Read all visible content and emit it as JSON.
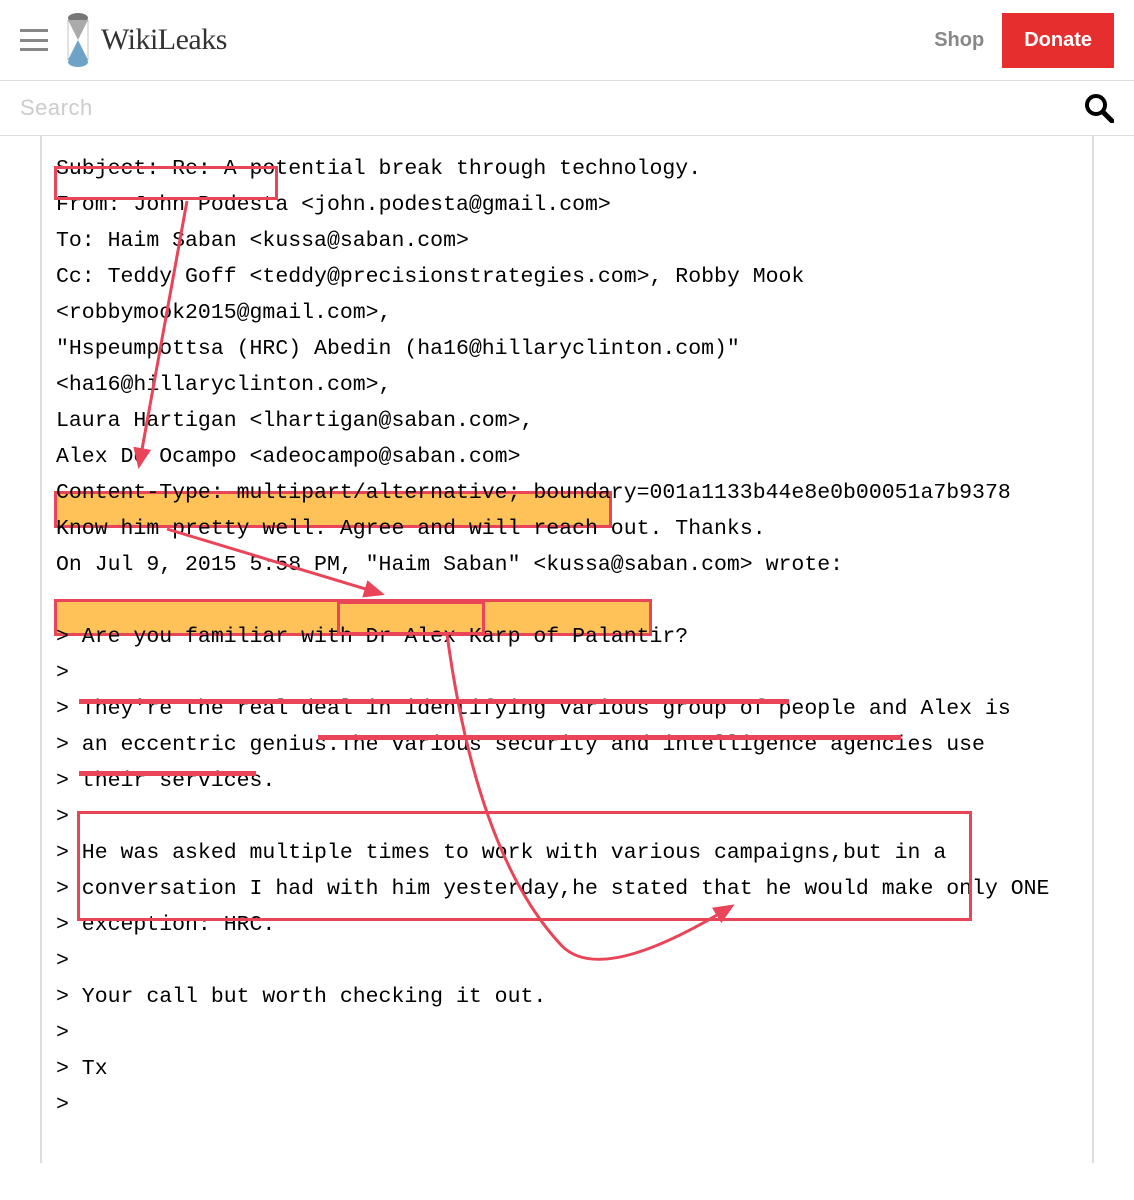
{
  "header": {
    "brand": "WikiLeaks",
    "shop": "Shop",
    "donate": "Donate"
  },
  "search": {
    "placeholder": "Search"
  },
  "email": {
    "subject": "Subject: Re: A potential break through technology.",
    "from_prefix": "From: John Podesta",
    "from_suffix": " <john.podesta@gmail.com>",
    "to": "To: Haim Saban <kussa@saban.com>",
    "cc1": "Cc: Teddy Goff <teddy@precisionstrategies.com>, Robby Mook",
    "cc2": "<robbymook2015@gmail.com>,",
    "cc3": "\"Hspeumpottsa (HRC) Abedin (ha16@hillaryclinton.com)\" <ha16@hillaryclinton.com>,",
    "cc4": "Laura Hartigan <lhartigan@saban.com>,",
    "cc5": "Alex De Ocampo <adeocampo@saban.com>",
    "content_type": "Content-Type: multipart/alternative; boundary=001a1133b44e8e0b00051a7b9378",
    "blank": "",
    "body_line1a": "Know him pretty well. Agree and will reach out.",
    "body_line1b": " Thanks.",
    "body_line2": "On Jul 9, 2015 5:58 PM, \"Haim Saban\" <kussa@saban.com> wrote:",
    "q1": "> Are you familiar with Dr Alex Karp of Palantir?",
    "q2": "> ",
    "q3": "> They're the real deal in identifying various group of people and Alex is",
    "q4": "> an eccentric genius.The various security and intelligence agencies use",
    "q5": "> their services.",
    "q6": "> ",
    "q7": "> He was asked multiple times to work with various campaigns,but in a",
    "q8": "> conversation I had with him yesterday,he stated that he would make only ONE",
    "q9": "> exception: HRC.",
    "q10": "> ",
    "q11": "> Your call but worth checking it out.",
    "q12": "> ",
    "q13": "> Tx",
    "q14": "> "
  }
}
